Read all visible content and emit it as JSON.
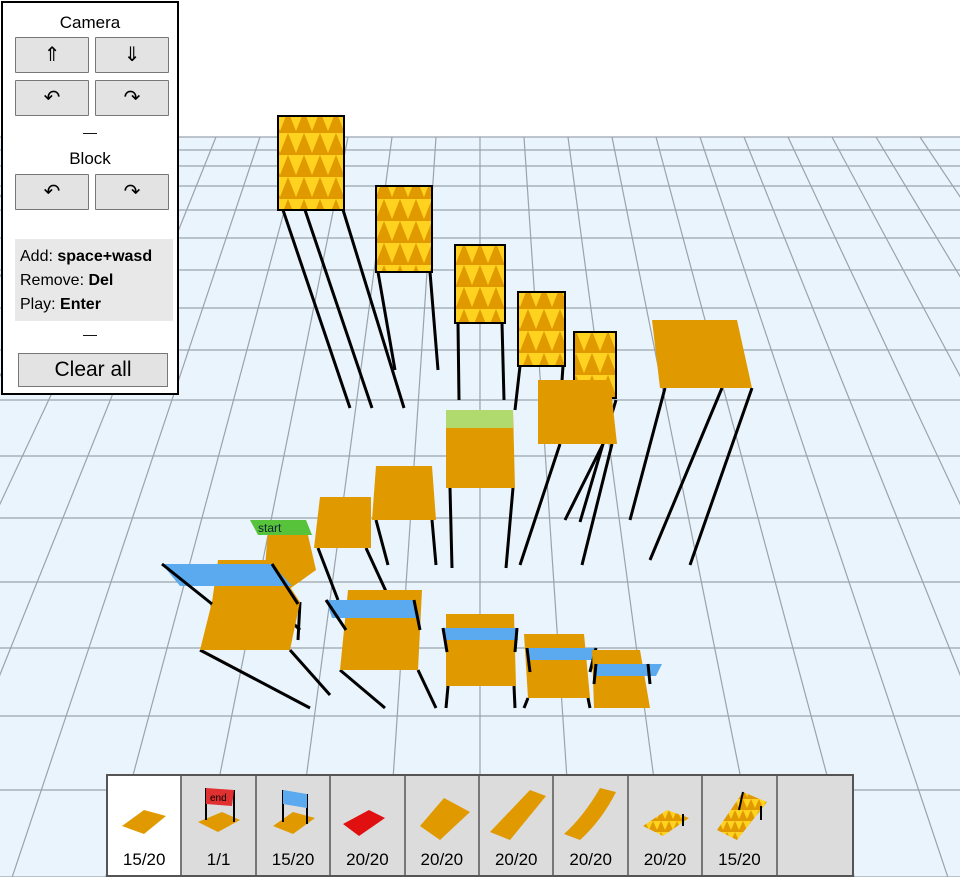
{
  "panel": {
    "camera_title": "Camera",
    "camera_buttons": {
      "up": "⇑",
      "down": "⇓",
      "rotate_left": "↶",
      "rotate_right": "↷"
    },
    "separator": "—",
    "block_title": "Block",
    "block_buttons": {
      "rotate_left": "↶",
      "rotate_right": "↷"
    },
    "help": [
      {
        "label": "Add: ",
        "key": "space+wasd"
      },
      {
        "label": "Remove: ",
        "key": "Del"
      },
      {
        "label": "Play: ",
        "key": "Enter"
      }
    ],
    "clear_label": "Clear all"
  },
  "scene": {
    "start_label": "start",
    "colors": {
      "block": "#e09a00",
      "spike": "#f2c400",
      "jump_pad": "#5baaf0",
      "grid_bg": "#eaf4fc",
      "grid_line": "#9aa3ad",
      "selection": "#9cf59c"
    }
  },
  "toolbar": {
    "tools": [
      {
        "icon": "flat-block-icon",
        "count": "15/20",
        "selected": true
      },
      {
        "icon": "end-flag-icon",
        "count": "1/1",
        "selected": false,
        "text": "end"
      },
      {
        "icon": "jump-pad-icon",
        "count": "15/20",
        "selected": false
      },
      {
        "icon": "red-block-icon",
        "count": "20/20",
        "selected": false
      },
      {
        "icon": "slope-block-icon",
        "count": "20/20",
        "selected": false
      },
      {
        "icon": "steep-slope-icon",
        "count": "20/20",
        "selected": false
      },
      {
        "icon": "curved-ramp-icon",
        "count": "20/20",
        "selected": false
      },
      {
        "icon": "spike-block-icon",
        "count": "20/20",
        "selected": false
      },
      {
        "icon": "spike-wall-icon",
        "count": "15/20",
        "selected": false
      },
      {
        "icon": "empty-slot",
        "count": "",
        "selected": false
      }
    ]
  }
}
